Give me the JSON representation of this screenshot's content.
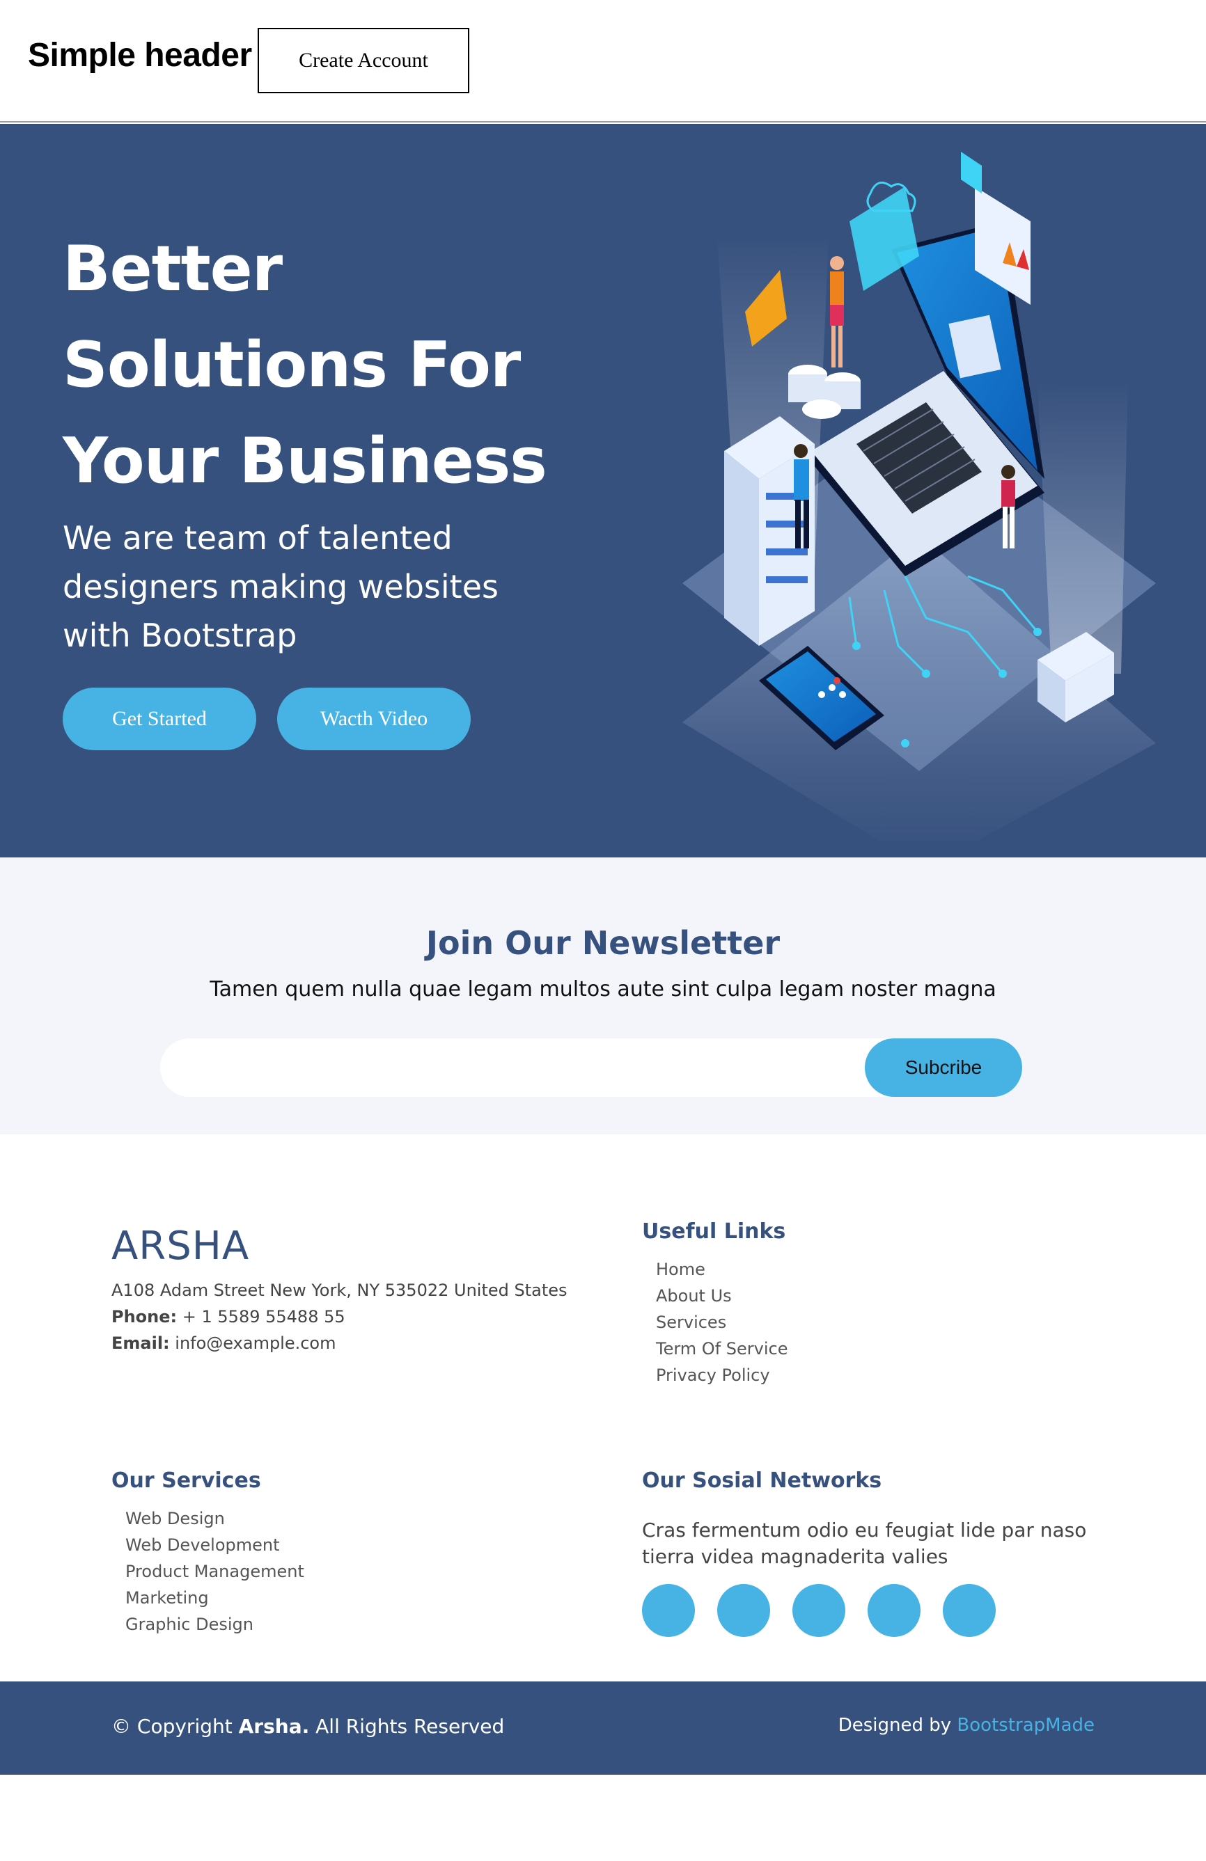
{
  "header": {
    "title": "Simple header",
    "create_account": "Create Account"
  },
  "hero": {
    "title": "Better Solutions For Your Business",
    "subtitle": "We are team of talented designers making websites with Bootstrap",
    "get_started": "Get Started",
    "watch_video": "Wacth Video",
    "illustration": "isometric-tech-illustration"
  },
  "newsletter": {
    "title": "Join Our Newsletter",
    "text": "Tamen quem nulla quae legam multos aute sint culpa legam noster magna",
    "email_value": "",
    "subscribe": "Subcribe"
  },
  "footer": {
    "brand": "ARSHA",
    "address": "A108 Adam Street New York, NY 535022 United States",
    "phone_label": "Phone:",
    "phone": "+ 1 5589 55488 55",
    "email_label": "Email:",
    "email": "info@example.com",
    "useful_links": {
      "title": "Useful Links",
      "items": [
        "Home",
        "About Us",
        "Services",
        "Term Of Service",
        "Privacy Policy"
      ]
    },
    "services": {
      "title": "Our Services",
      "items": [
        "Web Design",
        "Web Development",
        "Product Management",
        "Marketing",
        "Graphic Design"
      ]
    },
    "social": {
      "title": "Our Sosial Networks",
      "text": "Cras fermentum odio eu feugiat lide par naso tierra videa magnaderita valies",
      "count": 5
    }
  },
  "bottom": {
    "copyright_prefix": "© Copyright",
    "copyright_brand": "Arsha.",
    "copyright_suffix": "All Rights Reserved",
    "designed_by": "Designed by",
    "designer": "BootstrapMade"
  },
  "colors": {
    "primary": "#37517e",
    "accent": "#47b2e4",
    "newsletter_bg": "#f3f5fa"
  }
}
